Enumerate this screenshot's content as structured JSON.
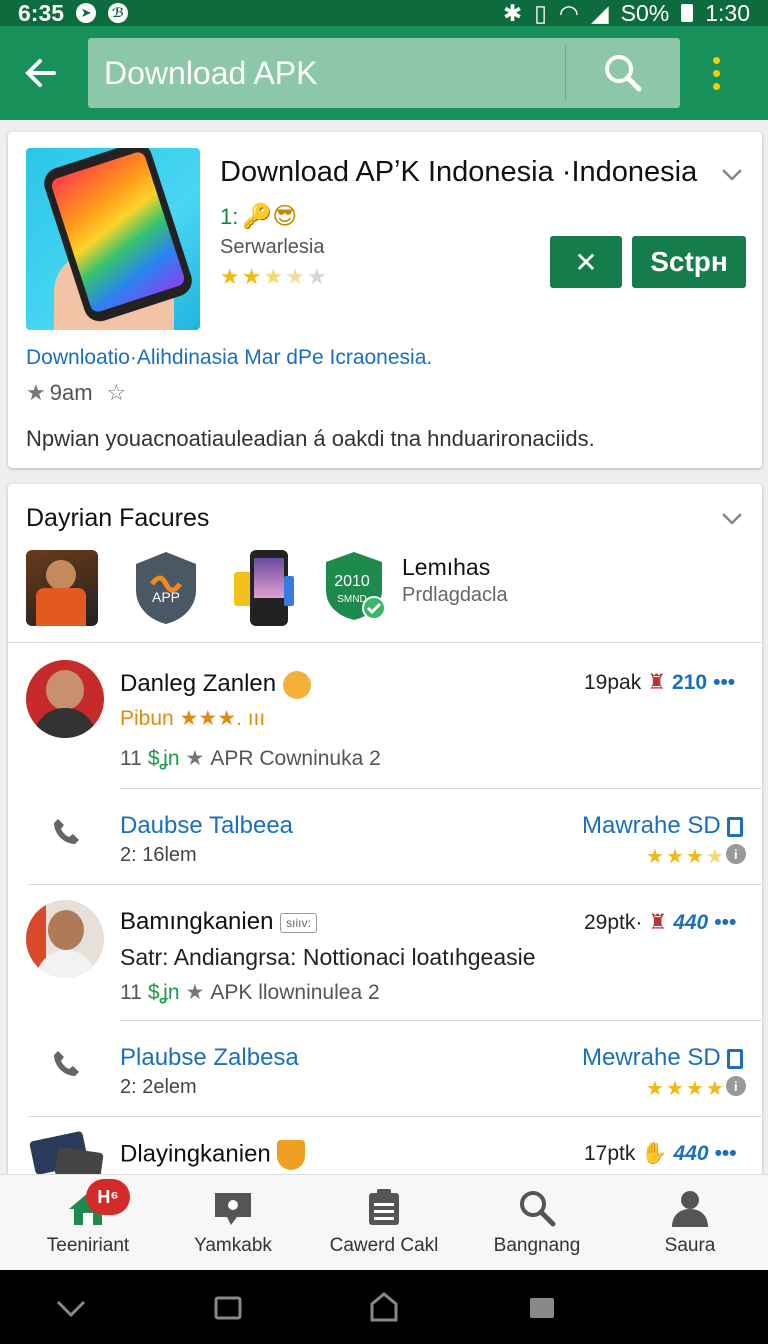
{
  "status": {
    "time_left": "6:35",
    "battery": "S0%",
    "time_right": "1:30"
  },
  "appbar": {
    "search_text": "Download APK"
  },
  "card1": {
    "title": "Download APʼK Indonesia ·Indonesia",
    "sub_prefix": "1:",
    "publisher": "Serwarlesia",
    "close_label": "✕",
    "action_label": "Sctpн",
    "link": "Downloatio·Alihdinasia Mar dPe Icraonesia.",
    "rating_text": "9am",
    "description": "Npwian youacnoatiauleadian á oakdi tna hnduarironaciids."
  },
  "features": {
    "section_title": "Dayrian Facures",
    "thumb_app_label": "APP",
    "thumb_badge_label": "2010",
    "thumb_badge_sub": "SMND",
    "name": "Lemıhas",
    "sub": "Prdlagdacla"
  },
  "reviews": [
    {
      "name": "Danleg Zanlen",
      "line2": "Pibun ★★★. ııı",
      "meta_num": "11",
      "meta_green": "$ʝn",
      "meta_text": "APR Cowninuka 2",
      "time": "19pak",
      "count": "210",
      "contact": "Daubse Talbeea",
      "contact_sub": "2: 16lem",
      "right_link": "Mawrahe SD"
    },
    {
      "name": "Bamıngkanien",
      "tag": "sıiıv:",
      "line2": "Satr: Andiangrsa: Nottionaci loatıhgeasie",
      "meta_num": "11",
      "meta_green": "$ʝn",
      "meta_text": "APK llowninulea 2",
      "time": "29ptk·",
      "count": "440",
      "contact": "Plaubse Zalbesa",
      "contact_sub": "2: 2elem",
      "right_link": "Mewrahe SD"
    },
    {
      "name": "Dlayingkanien",
      "time": "17ptk",
      "count": "440"
    }
  ],
  "bottom_nav": [
    {
      "label": "Teeniriant",
      "badge": "H⁶"
    },
    {
      "label": "Yamkabk"
    },
    {
      "label": "Cawerd Cakl"
    },
    {
      "label": "Bangnang"
    },
    {
      "label": "Saura"
    }
  ],
  "colors": {
    "primary": "#17905a",
    "dark_primary": "#0e6b3e",
    "link": "#1a6fc0",
    "star": "#f1b913"
  }
}
